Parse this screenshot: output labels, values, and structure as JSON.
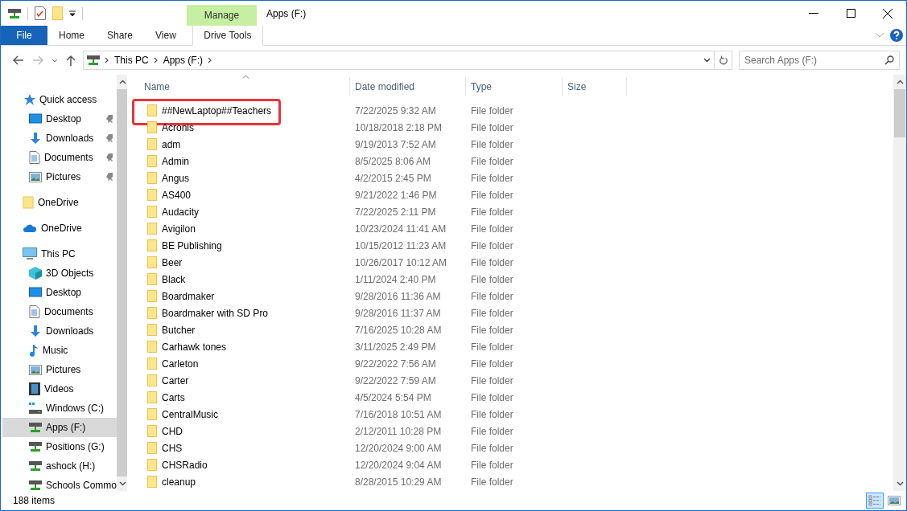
{
  "window": {
    "title": "Apps (F:)",
    "context_tab_group": "Manage"
  },
  "ribbon_tabs": [
    {
      "label": "File",
      "kind": "file"
    },
    {
      "label": "Home",
      "kind": "normal"
    },
    {
      "label": "Share",
      "kind": "normal"
    },
    {
      "label": "View",
      "kind": "normal"
    },
    {
      "label": "Drive Tools",
      "kind": "context"
    }
  ],
  "address_bar": {
    "path": [
      "This PC",
      "Apps (F:)"
    ]
  },
  "search": {
    "placeholder": "Search Apps (F:)"
  },
  "navigation_pane": {
    "items": [
      {
        "label": "Quick access",
        "kind": "star",
        "children": [
          {
            "label": "Desktop",
            "kind": "desktop",
            "pinned": true
          },
          {
            "label": "Downloads",
            "kind": "download",
            "pinned": true
          },
          {
            "label": "Documents",
            "kind": "document",
            "pinned": true
          },
          {
            "label": "Pictures",
            "kind": "picture",
            "pinned": true
          }
        ]
      },
      {
        "label": "OneDrive",
        "kind": "folder"
      },
      {
        "label": "OneDrive",
        "kind": "cloud"
      },
      {
        "label": "This PC",
        "kind": "pc",
        "children": [
          {
            "label": "3D Objects",
            "kind": "cube",
            "selected": false
          },
          {
            "label": "Desktop",
            "kind": "desktop",
            "selected": false
          },
          {
            "label": "Documents",
            "kind": "document",
            "selected": false
          },
          {
            "label": "Downloads",
            "kind": "download",
            "selected": false
          },
          {
            "label": "Music",
            "kind": "music",
            "selected": false
          },
          {
            "label": "Pictures",
            "kind": "picture",
            "selected": false
          },
          {
            "label": "Videos",
            "kind": "video",
            "selected": false
          },
          {
            "label": "Windows (C:)",
            "kind": "windrive",
            "selected": false
          },
          {
            "label": "Apps (F:)",
            "kind": "netdrive",
            "selected": true
          },
          {
            "label": "Positions (G:)",
            "kind": "netdrive",
            "selected": false
          },
          {
            "label": "ashock (H:)",
            "kind": "netdrive",
            "selected": false
          },
          {
            "label": "Schools Commo",
            "kind": "netdrive",
            "selected": false
          }
        ]
      }
    ]
  },
  "file_list": {
    "columns": [
      "Name",
      "Date modified",
      "Type",
      "Size"
    ],
    "rows": [
      {
        "name": "##NewLaptop##Teachers",
        "date": "7/22/2025 9:32 AM",
        "type": "File folder",
        "annotated": true
      },
      {
        "name": "Acronis",
        "date": "10/18/2018 2:18 PM",
        "type": "File folder",
        "annotated": false
      },
      {
        "name": "adm",
        "date": "9/19/2013 7:52 AM",
        "type": "File folder",
        "annotated": false
      },
      {
        "name": "Admin",
        "date": "8/5/2025 8:06 AM",
        "type": "File folder",
        "annotated": false
      },
      {
        "name": "Angus",
        "date": "4/2/2015 2:45 PM",
        "type": "File folder",
        "annotated": false
      },
      {
        "name": "AS400",
        "date": "9/21/2022 1:46 PM",
        "type": "File folder",
        "annotated": false
      },
      {
        "name": "Audacity",
        "date": "7/22/2025 2:11 PM",
        "type": "File folder",
        "annotated": false
      },
      {
        "name": "Avigilon",
        "date": "10/23/2024 11:41 AM",
        "type": "File folder",
        "annotated": false
      },
      {
        "name": "BE Publishing",
        "date": "10/15/2012 11:23 AM",
        "type": "File folder",
        "annotated": false
      },
      {
        "name": "Beer",
        "date": "10/26/2017 10:12 AM",
        "type": "File folder",
        "annotated": false
      },
      {
        "name": "Black",
        "date": "1/11/2024 2:40 PM",
        "type": "File folder",
        "annotated": false
      },
      {
        "name": "Boardmaker",
        "date": "9/28/2016 11:36 AM",
        "type": "File folder",
        "annotated": false
      },
      {
        "name": "Boardmaker with SD Pro",
        "date": "9/28/2016 11:37 AM",
        "type": "File folder",
        "annotated": false
      },
      {
        "name": "Butcher",
        "date": "7/16/2025 10:28 AM",
        "type": "File folder",
        "annotated": false
      },
      {
        "name": "Carhawk tones",
        "date": "3/11/2025 2:49 PM",
        "type": "File folder",
        "annotated": false
      },
      {
        "name": "Carleton",
        "date": "9/22/2022 7:56 AM",
        "type": "File folder",
        "annotated": false
      },
      {
        "name": "Carter",
        "date": "9/22/2022 7:59 AM",
        "type": "File folder",
        "annotated": false
      },
      {
        "name": "Carts",
        "date": "4/5/2024 5:54 PM",
        "type": "File folder",
        "annotated": false
      },
      {
        "name": "CentralMusic",
        "date": "7/16/2018 10:51 AM",
        "type": "File folder",
        "annotated": false
      },
      {
        "name": "CHD",
        "date": "2/12/2011 10:28 PM",
        "type": "File folder",
        "annotated": false
      },
      {
        "name": "CHS",
        "date": "12/20/2024 9:00 AM",
        "type": "File folder",
        "annotated": false
      },
      {
        "name": "CHSRadio",
        "date": "12/20/2024 9:04 AM",
        "type": "File folder",
        "annotated": false
      },
      {
        "name": "cleanup",
        "date": "8/28/2015 10:29 AM",
        "type": "File folder",
        "annotated": false
      }
    ]
  },
  "status_bar": {
    "item_count": "188 items",
    "views": [
      {
        "kind": "details",
        "selected": true
      },
      {
        "kind": "thumbnails",
        "selected": false
      }
    ]
  }
}
